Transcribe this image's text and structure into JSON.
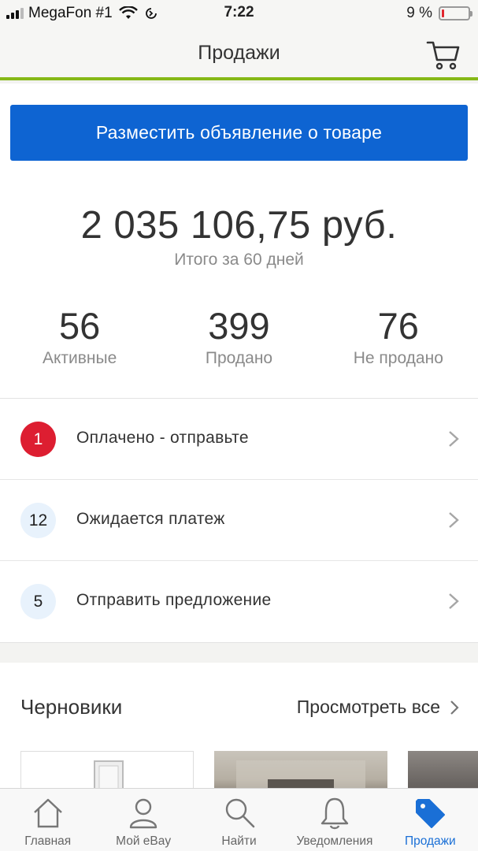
{
  "status_bar": {
    "carrier": "MegaFon #1",
    "time": "7:22",
    "battery_percent": "9 %",
    "battery_level": 0.09
  },
  "nav": {
    "title": "Продажи"
  },
  "sell": {
    "button_label": "Разместить объявление о товаре"
  },
  "summary": {
    "total": "2 035 106,75 руб.",
    "caption": "Итого за 60 дней",
    "stats": [
      {
        "value": "56",
        "label": "Активные"
      },
      {
        "value": "399",
        "label": "Продано"
      },
      {
        "value": "76",
        "label": "Не продано"
      }
    ]
  },
  "tasks": [
    {
      "badge": "1",
      "label": "Оплачено - отправьте",
      "badge_color": "#dd1e31"
    },
    {
      "badge": "12",
      "label": "Ожидается платеж",
      "badge_color": "#e8f2fc"
    },
    {
      "badge": "5",
      "label": "Отправить предложение",
      "badge_color": "#e8f2fc"
    }
  ],
  "drafts": {
    "title": "Черновики",
    "view_all": "Просмотреть все"
  },
  "tab_bar": {
    "items": [
      {
        "label": "Главная",
        "icon": "home-icon"
      },
      {
        "label": "Мой eBay",
        "icon": "person-icon"
      },
      {
        "label": "Найти",
        "icon": "search-icon"
      },
      {
        "label": "Уведомления",
        "icon": "bell-icon"
      },
      {
        "label": "Продажи",
        "icon": "tag-icon"
      }
    ],
    "active": "Продажи"
  },
  "colors": {
    "accent": "#0e64d2",
    "nav_underline": "#86b817",
    "badge_alert": "#dd1e31",
    "active_tab": "#1a6fd6"
  }
}
